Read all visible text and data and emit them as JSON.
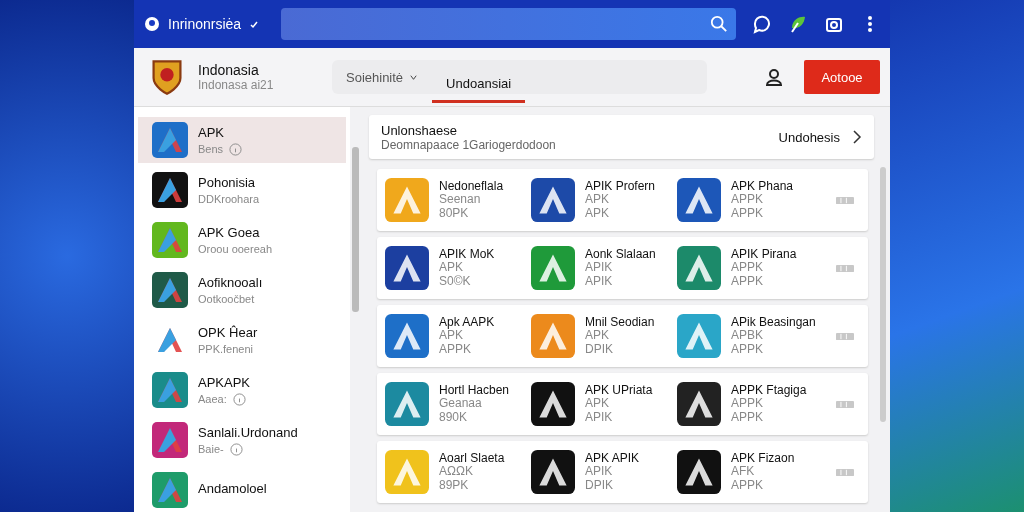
{
  "top_bar": {
    "title": "Inrinonrsiėa"
  },
  "header": {
    "brand": {
      "name": "Indonasia",
      "subtitle": "Indonasa ai21"
    },
    "tabs": [
      {
        "label": "Soiehinitė",
        "selected": false,
        "dropdown": true
      },
      {
        "label": "Undoansiai",
        "selected": true,
        "dropdown": false
      }
    ],
    "action_button": "Aotooe"
  },
  "sidebar": {
    "items": [
      {
        "title": "APK",
        "subtitle": "Bens",
        "kind": "info",
        "color": "#1e6fc8",
        "selected": true
      },
      {
        "title": "Pohonisia",
        "subtitle": "DDKroohara",
        "kind": "plain",
        "color": "#111111",
        "selected": false
      },
      {
        "title": "APK Goea",
        "subtitle": "Oroou ooereah",
        "kind": "plain",
        "color": "#62b81e",
        "selected": false
      },
      {
        "title": "Aofiknooalı",
        "subtitle": "Ootkoočbet",
        "kind": "plain",
        "color": "#1f5a48",
        "selected": false
      },
      {
        "title": "OPK Ĥear",
        "subtitle": "PPK.feneni",
        "kind": "plain",
        "color": "#ffffff",
        "selected": false
      },
      {
        "title": "APKAPK",
        "subtitle": "Aaea:",
        "kind": "info",
        "color": "#1a8c8a",
        "selected": false
      },
      {
        "title": "Sanlali.Urdonand",
        "subtitle": "Baie-",
        "kind": "info",
        "color": "#c2287a",
        "selected": false
      },
      {
        "title": "Andamoloel",
        "kind": "plain",
        "color": "#1e9c6a",
        "selected": false
      }
    ]
  },
  "featured": {
    "title": "Unlonshaese",
    "subtitle": "Deomnapaace 1Gariogerdodoon",
    "link": "Undohesis"
  },
  "app_rows": [
    {
      "apps": [
        {
          "name": "Nedoneflala",
          "line_2": "Seenan",
          "line_3": "80PK",
          "color": "#f0a81c"
        },
        {
          "name": "APIK Profern",
          "line_2": "APK",
          "line_3": "APK",
          "color": "#1d4aa8"
        },
        {
          "name": "APK Phana",
          "line_2": "APPK",
          "line_3": "APPK",
          "color": "#1d57b8"
        }
      ]
    },
    {
      "apps": [
        {
          "name": "APIK MoK",
          "line_2": "APK",
          "line_3": "S0©K",
          "color": "#1c3fa0"
        },
        {
          "name": "Aonk Slalaan",
          "line_2": "APIK",
          "line_3": "APIK",
          "color": "#1f9a3a"
        },
        {
          "name": "APIK Pirana",
          "line_2": "APPK",
          "line_3": "APPK",
          "color": "#1c8a6a"
        }
      ]
    },
    {
      "apps": [
        {
          "name": "Apk AAPK",
          "line_2": "APK",
          "line_3": "APPK",
          "color": "#1e6fc8"
        },
        {
          "name": "Mnil Seodian",
          "line_2": "APK",
          "line_3": "DPIK",
          "color": "#ec8a1c"
        },
        {
          "name": "APik Beasingan",
          "line_2": "APBK",
          "line_3": "APPK",
          "color": "#2aa6c8"
        }
      ]
    },
    {
      "apps": [
        {
          "name": "Hortl Hacben",
          "line_2": "Geanaa",
          "line_3": "890K",
          "color": "#1c8aa0"
        },
        {
          "name": "APK UPriata",
          "line_2": "APK",
          "line_3": "APIK",
          "color": "#111111"
        },
        {
          "name": "APPK Ftagiga",
          "line_2": "APPK",
          "line_3": "APPK",
          "color": "#222222"
        }
      ]
    },
    {
      "apps": [
        {
          "name": "Aoarl Slaeta",
          "line_2": "AΩΩK",
          "line_3": "89PK",
          "color": "#f0c21c"
        },
        {
          "name": "APK APIK",
          "line_2": "APIK",
          "line_3": "DPIK",
          "color": "#111111"
        },
        {
          "name": "APK Fizaon",
          "line_2": "AFK",
          "line_3": "APPK",
          "color": "#111111"
        }
      ]
    }
  ]
}
